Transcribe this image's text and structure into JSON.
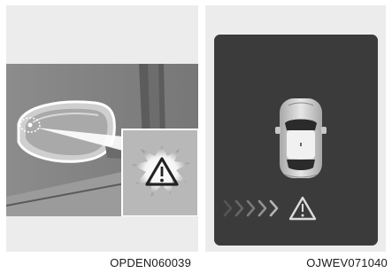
{
  "figures": [
    {
      "id": "figure-left",
      "caption": "OPDEN060039",
      "icons": [
        "side-mirror",
        "mirror-warning-light",
        "warning-triangle-icon"
      ]
    },
    {
      "id": "figure-right",
      "caption": "OJWEV071040",
      "icons": [
        "vehicle-top-view",
        "approaching-chevrons",
        "warning-triangle-icon"
      ]
    }
  ],
  "colors": {
    "panel_background": "#ececec",
    "display_background": "#3b3b3b",
    "warning_glyph": "#222222"
  }
}
